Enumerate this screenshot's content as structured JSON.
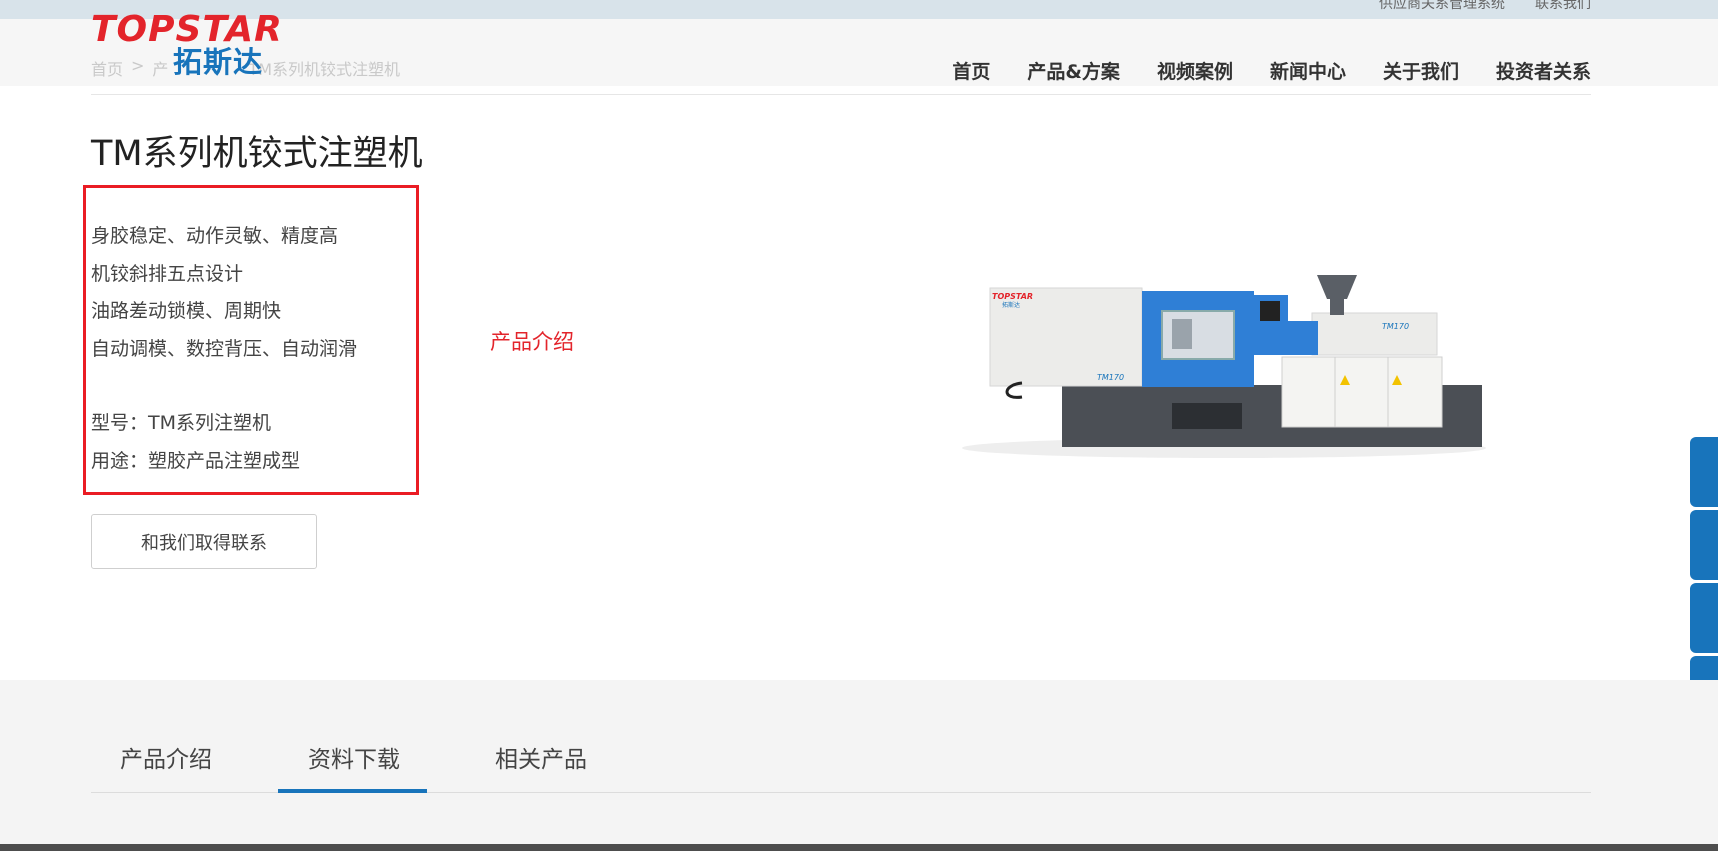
{
  "topbar": {
    "links": [
      "供应商关系管理系统",
      "联系我们"
    ]
  },
  "logo": {
    "en": "TOPSTAR",
    "cn": "拓斯达"
  },
  "breadcrumb": [
    "首页",
    ">",
    "产",
    "TM系列机铰式注塑机"
  ],
  "nav": {
    "items": [
      "首页",
      "产品&方案",
      "视频案例",
      "新闻中心",
      "关于我们",
      "投资者关系"
    ]
  },
  "product": {
    "title": "TM系列机铰式注塑机",
    "features": [
      "身胶稳定、动作灵敏、精度高",
      "机铰斜排五点设计",
      "油路差动锁模、周期快",
      "自动调模、数控背压、自动润滑"
    ],
    "model": "型号：TM系列注塑机",
    "usage": "用途：塑胶产品注塑成型",
    "annotation_label": "产品介绍",
    "contact_button": "和我们取得联系",
    "machine_logo": "TOPSTAR",
    "machine_logo_cn": "拓斯达",
    "machine_model": "TM170"
  },
  "tabs": {
    "items": [
      "产品介绍",
      "资料下载",
      "相关产品"
    ],
    "active_index": 1
  },
  "colors": {
    "brand_red": "#e3242b",
    "brand_blue": "#1874bb",
    "annotation_red": "#ea1c24"
  }
}
